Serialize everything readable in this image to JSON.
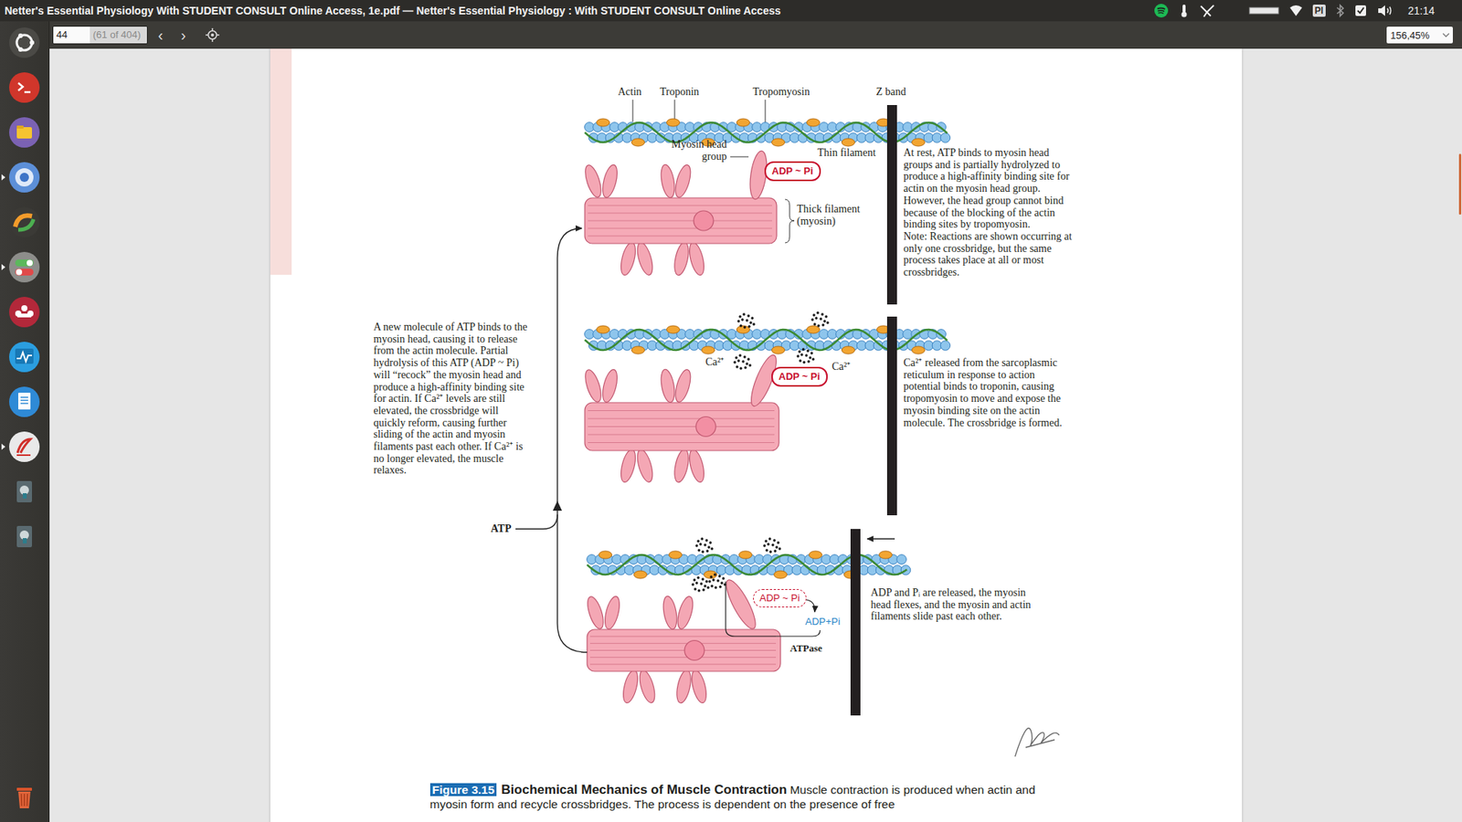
{
  "window": {
    "title": "Netter's Essential Physiology With STUDENT CONSULT Online Access, 1e.pdf — Netter's Essential Physiology : With STUDENT CONSULT Online Access"
  },
  "tray": {
    "keyboard": "Pl",
    "clock": "21:14"
  },
  "toolbar": {
    "page": "44",
    "page_of": "(61 of 404)",
    "prev": "‹",
    "next": "›",
    "zoom": "156,45%"
  },
  "figure": {
    "top_labels": {
      "actin": "Actin",
      "troponin": "Troponin",
      "tropomyosin": "Tropomyosin",
      "z_band": "Z band"
    },
    "myosin_head_label": [
      "Myosin head",
      "group"
    ],
    "thin_filament_label": "Thin filament",
    "thick_filament_label": [
      "Thick filament",
      "(myosin)"
    ],
    "panels": [
      {
        "calcium_bound": false,
        "calcium": [],
        "complex": {
          "text": "ADP ~ Pi",
          "kind": "bound"
        },
        "products": "",
        "enzyme": "",
        "text": [
          "At rest, ATP binds to myosin head",
          "groups and is partially hydrolyzed to",
          "produce a high-affinity binding site for",
          "actin on the myosin head group.",
          "However, the head group cannot bind",
          "because of the blocking of the actin",
          "binding sites by tropomyosin.",
          "Note: Reactions are shown occurring at",
          "only one crossbridge, but the same",
          "process takes place at all or most",
          "crossbridges."
        ]
      },
      {
        "calcium_bound": true,
        "calcium": [
          "Ca²⁺",
          "Ca²⁺"
        ],
        "complex": {
          "text": "ADP ~ Pi",
          "kind": "bound"
        },
        "products": "",
        "enzyme": "",
        "text": [
          "Ca²⁺ released from the sarcoplasmic",
          "reticulum in response to action",
          "potential binds to troponin, causing",
          "tropomyosin to move and expose the",
          "myosin binding site on the actin",
          "molecule. The crossbridge is formed."
        ]
      },
      {
        "calcium_bound": true,
        "calcium": [],
        "complex": {
          "text": "ADP ~ Pi",
          "kind": "released"
        },
        "products": "ADP+Pi",
        "enzyme": "ATPase",
        "text": [
          "ADP and Pᵢ are released, the myosin",
          "head flexes, and the myosin and actin",
          "filaments slide past each other."
        ]
      }
    ],
    "cycle_text": [
      "A new molecule of ATP binds to the",
      "myosin head, causing it to release",
      "from the actin molecule. Partial",
      "hydrolysis of this ATP (ADP ~ Pi)",
      "will “recock” the myosin head and",
      "produce a high-affinity binding site",
      "for actin. If Ca²⁺ levels are still",
      "elevated, the crossbridge will",
      "quickly reform, causing further",
      "sliding of the actin and myosin",
      "filaments past each other. If Ca²⁺ is",
      "no longer elevated, the muscle",
      "relaxes."
    ],
    "cycle_input": "ATP"
  },
  "caption": {
    "number": "Figure 3.15",
    "title": "Biochemical Mechanics of Muscle Contraction",
    "body": "Muscle contraction is produced when actin and myosin form and recycle crossbridges. The process is dependent on the presence of free"
  }
}
